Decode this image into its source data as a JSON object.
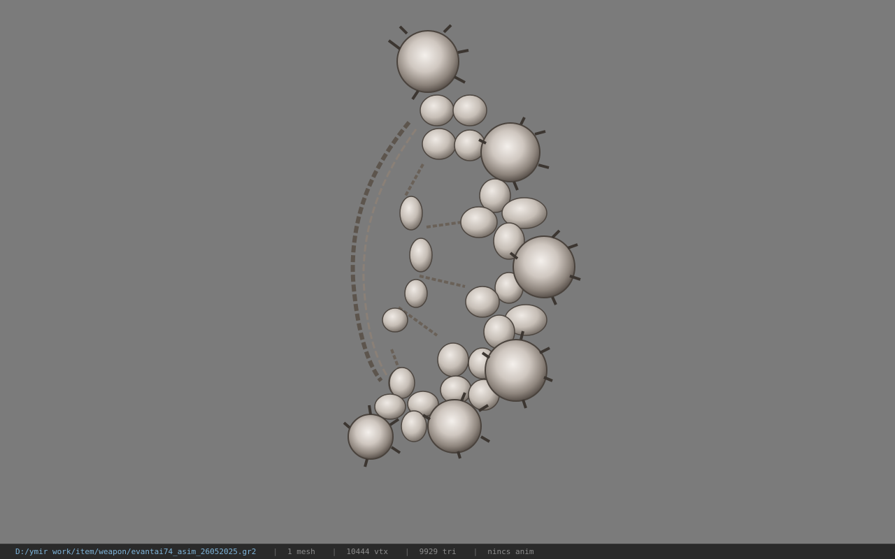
{
  "viewport": {
    "background": "#7b7b7b",
    "model": "jeweled fan weapon (chain, flower clusters, prong-set gems)"
  },
  "statusbar": {
    "file_path": "D:/ymir work/item/weapon/evantai74_asim_26052025.gr2",
    "separator": "|",
    "mesh_count": "1 mesh",
    "vertex_count": "10444 vtx",
    "triangle_count": "9929 tri",
    "anim_status": "nincs anim",
    "path_color": "#7fb4d9",
    "bar_color": "#2a2a2a"
  }
}
